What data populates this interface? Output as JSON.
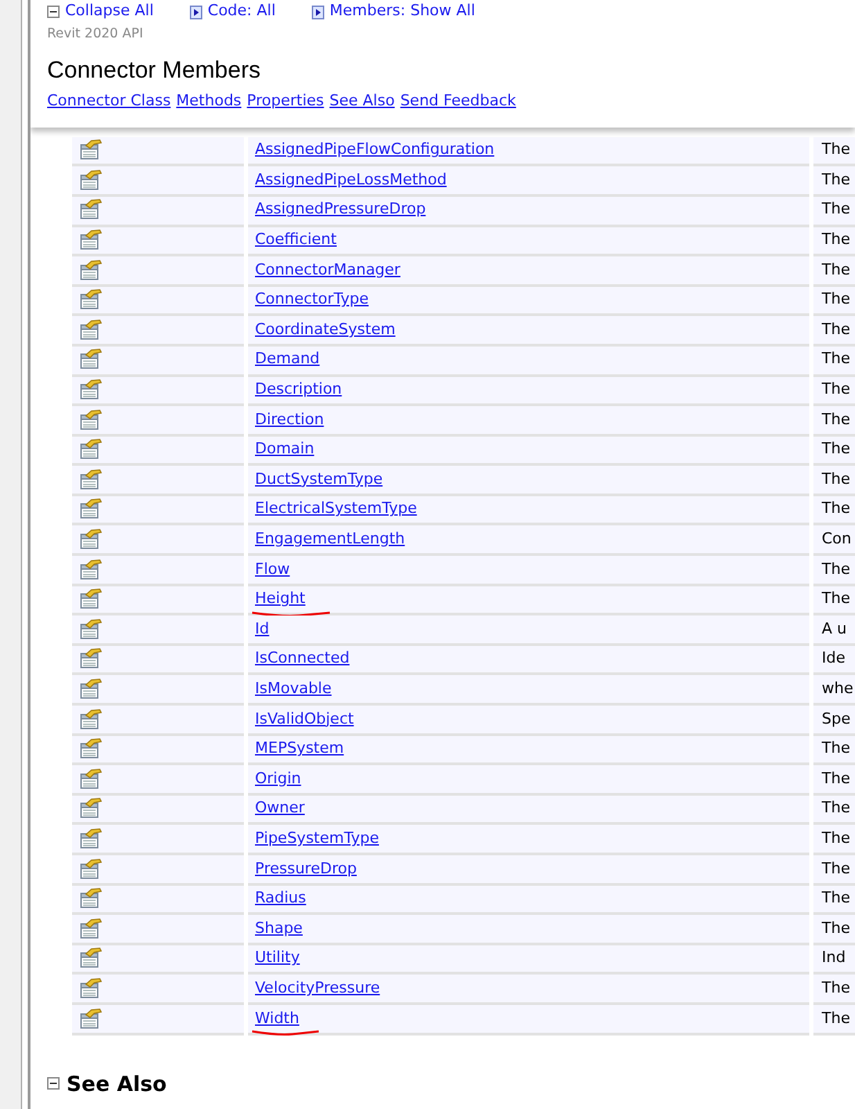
{
  "toolbar": [
    {
      "kind": "collapse",
      "label": "Collapse All"
    },
    {
      "kind": "expand",
      "label": "Code: All"
    },
    {
      "kind": "expand",
      "label": "Members: Show All"
    }
  ],
  "product": "Revit 2020 API",
  "title": "Connector Members",
  "links": [
    "Connector Class",
    "Methods",
    "Properties",
    "See Also",
    "Send Feedback"
  ],
  "rows": [
    {
      "name": "AssignedPipeFlowConfiguration",
      "description": "The",
      "underlined": false
    },
    {
      "name": "AssignedPipeLossMethod",
      "description": "The",
      "underlined": false
    },
    {
      "name": "AssignedPressureDrop",
      "description": "The",
      "underlined": false
    },
    {
      "name": "Coefficient",
      "description": "The",
      "underlined": false
    },
    {
      "name": "ConnectorManager",
      "description": "The",
      "underlined": false
    },
    {
      "name": "ConnectorType",
      "description": "The",
      "underlined": false
    },
    {
      "name": "CoordinateSystem",
      "description": "The",
      "underlined": false
    },
    {
      "name": "Demand",
      "description": "The",
      "underlined": false
    },
    {
      "name": "Description",
      "description": "The",
      "underlined": false
    },
    {
      "name": "Direction",
      "description": "The",
      "underlined": false
    },
    {
      "name": "Domain",
      "description": "The",
      "underlined": false
    },
    {
      "name": "DuctSystemType",
      "description": "The",
      "underlined": false
    },
    {
      "name": "ElectricalSystemType",
      "description": "The",
      "underlined": false
    },
    {
      "name": "EngagementLength",
      "description": "Con",
      "underlined": false
    },
    {
      "name": "Flow",
      "description": "The",
      "underlined": false
    },
    {
      "name": "Height",
      "description": "The",
      "underlined": true
    },
    {
      "name": "Id",
      "description": "A u",
      "underlined": false
    },
    {
      "name": "IsConnected",
      "description": "Ide",
      "underlined": false
    },
    {
      "name": "IsMovable",
      "description": "whe",
      "underlined": false
    },
    {
      "name": "IsValidObject",
      "description": "Spe",
      "underlined": false
    },
    {
      "name": "MEPSystem",
      "description": "The",
      "underlined": false
    },
    {
      "name": "Origin",
      "description": "The",
      "underlined": false
    },
    {
      "name": "Owner",
      "description": "The",
      "underlined": false
    },
    {
      "name": "PipeSystemType",
      "description": "The",
      "underlined": false
    },
    {
      "name": "PressureDrop",
      "description": "The",
      "underlined": false
    },
    {
      "name": "Radius",
      "description": "The",
      "underlined": false
    },
    {
      "name": "Shape",
      "description": "The",
      "underlined": false
    },
    {
      "name": "Utility",
      "description": "Ind",
      "underlined": false
    },
    {
      "name": "VelocityPressure",
      "description": "The",
      "underlined": false
    },
    {
      "name": "Width",
      "description": "The",
      "underlined": true
    }
  ],
  "section": {
    "kind": "collapse",
    "title": "See Also"
  }
}
